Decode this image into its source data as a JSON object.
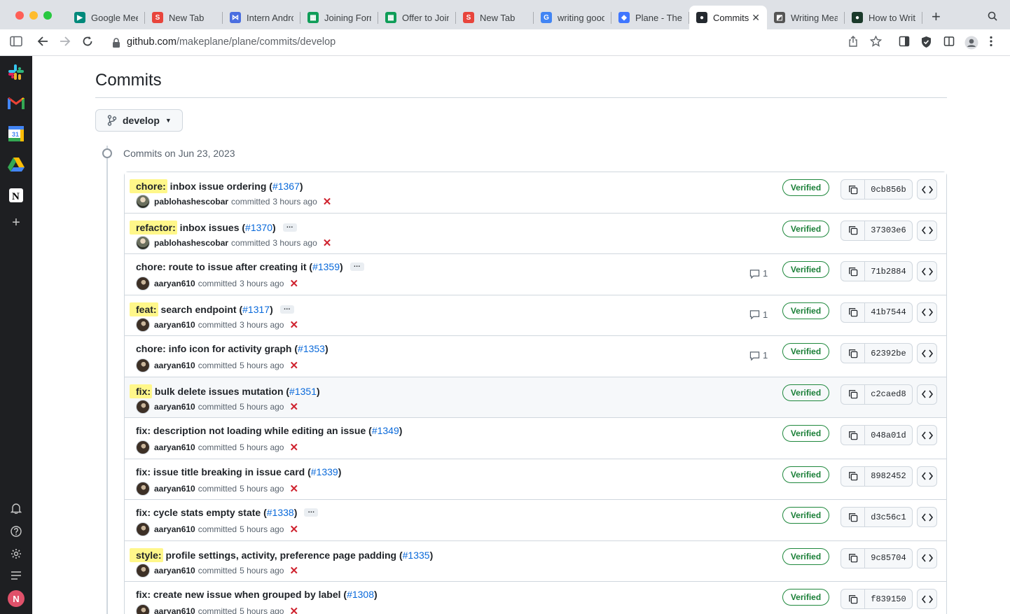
{
  "browser": {
    "tabs": [
      {
        "label": "Google Meet",
        "icon": "google-meet-icon",
        "color": "#00897b",
        "glyph": "▶"
      },
      {
        "label": "New Tab",
        "icon": "slash-icon",
        "color": "#e8453c",
        "glyph": "S"
      },
      {
        "label": "Intern Andrc",
        "icon": "bowtie-icon",
        "color": "#4a6ee0",
        "glyph": "⋈"
      },
      {
        "label": "Joining Form",
        "icon": "sheets-icon",
        "color": "#0f9d58",
        "glyph": "▦"
      },
      {
        "label": "Offer to Join",
        "icon": "sheets-icon",
        "color": "#0f9d58",
        "glyph": "▦"
      },
      {
        "label": "New Tab",
        "icon": "slash-icon",
        "color": "#e8453c",
        "glyph": "S"
      },
      {
        "label": "writing good",
        "icon": "google-icon",
        "color": "#4285f4",
        "glyph": "G"
      },
      {
        "label": "Plane - The",
        "icon": "plane-icon",
        "color": "#3f76ff",
        "glyph": "◆"
      },
      {
        "label": "Commits",
        "icon": "github-icon",
        "color": "#24292f",
        "glyph": "●",
        "active": true
      },
      {
        "label": "Writing Mea",
        "icon": "writing-icon",
        "color": "#555",
        "glyph": "◩"
      },
      {
        "label": "How to Writ",
        "icon": "medium-icon",
        "color": "#1b3a2b",
        "glyph": "●"
      }
    ],
    "url_host": "github.com",
    "url_path": "/makeplane/plane/commits/develop"
  },
  "page": {
    "title": "Commits",
    "branch": "develop",
    "date_heading": "Commits on Jun 23, 2023"
  },
  "commits": [
    {
      "prefix": "chore:",
      "highlight": true,
      "message": " inbox issue ordering (",
      "pr": "#1367",
      "suffix": ")",
      "ellipsis": false,
      "author": "pablohashescobar",
      "avatar": "alt",
      "verb": "committed",
      "time": "3 hours ago",
      "comments": "",
      "verified": "Verified",
      "sha": "0cb856b"
    },
    {
      "prefix": "refactor:",
      "highlight": true,
      "message": " inbox issues (",
      "pr": "#1370",
      "suffix": ")",
      "ellipsis": true,
      "author": "pablohashescobar",
      "avatar": "alt",
      "verb": "committed",
      "time": "3 hours ago",
      "comments": "",
      "verified": "Verified",
      "sha": "37303e6"
    },
    {
      "prefix": "",
      "highlight": false,
      "message": "chore: route to issue after creating it (",
      "pr": "#1359",
      "suffix": ")",
      "ellipsis": true,
      "author": "aaryan610",
      "avatar": "main",
      "verb": "committed",
      "time": "3 hours ago",
      "comments": "1",
      "verified": "Verified",
      "sha": "71b2884"
    },
    {
      "prefix": "feat:",
      "highlight": true,
      "message": " search endpoint (",
      "pr": "#1317",
      "suffix": ")",
      "ellipsis": true,
      "author": "aaryan610",
      "avatar": "main",
      "verb": "committed",
      "time": "3 hours ago",
      "comments": "1",
      "verified": "Verified",
      "sha": "41b7544"
    },
    {
      "prefix": "",
      "highlight": false,
      "message": "chore: info icon for activity graph (",
      "pr": "#1353",
      "suffix": ")",
      "ellipsis": false,
      "author": "aaryan610",
      "avatar": "main",
      "verb": "committed",
      "time": "5 hours ago",
      "comments": "1",
      "verified": "Verified",
      "sha": "62392be"
    },
    {
      "prefix": "fix:",
      "highlight": true,
      "message": " bulk delete issues mutation (",
      "pr": "#1351",
      "suffix": ")",
      "ellipsis": false,
      "author": "aaryan610",
      "avatar": "main",
      "verb": "committed",
      "time": "5 hours ago",
      "comments": "",
      "verified": "Verified",
      "sha": "c2caed8",
      "hover": true
    },
    {
      "prefix": "",
      "highlight": false,
      "message": "fix: description not loading while editing an issue (",
      "pr": "#1349",
      "suffix": ")",
      "ellipsis": false,
      "author": "aaryan610",
      "avatar": "main",
      "verb": "committed",
      "time": "5 hours ago",
      "comments": "",
      "verified": "Verified",
      "sha": "048a01d"
    },
    {
      "prefix": "",
      "highlight": false,
      "message": "fix: issue title breaking in issue card (",
      "pr": "#1339",
      "suffix": ")",
      "ellipsis": false,
      "author": "aaryan610",
      "avatar": "main",
      "verb": "committed",
      "time": "5 hours ago",
      "comments": "",
      "verified": "Verified",
      "sha": "8982452"
    },
    {
      "prefix": "",
      "highlight": false,
      "message": "fix: cycle stats empty state (",
      "pr": "#1338",
      "suffix": ")",
      "ellipsis": true,
      "author": "aaryan610",
      "avatar": "main",
      "verb": "committed",
      "time": "5 hours ago",
      "comments": "",
      "verified": "Verified",
      "sha": "d3c56c1"
    },
    {
      "prefix": "style:",
      "highlight": true,
      "message": " profile settings, activity, preference page padding (",
      "pr": "#1335",
      "suffix": ")",
      "ellipsis": false,
      "author": "aaryan610",
      "avatar": "main",
      "verb": "committed",
      "time": "5 hours ago",
      "comments": "",
      "verified": "Verified",
      "sha": "9c85704"
    },
    {
      "prefix": "",
      "highlight": false,
      "message": "fix: create new issue when grouped by label (",
      "pr": "#1308",
      "suffix": ")",
      "ellipsis": false,
      "author": "aaryan610",
      "avatar": "main",
      "verb": "committed",
      "time": "5 hours ago",
      "comments": "",
      "verified": "Verified",
      "sha": "f839150"
    }
  ],
  "dock": {
    "avatar_initial": "N",
    "apps": [
      "slack-icon",
      "gmail-icon",
      "calendar-icon",
      "drive-icon",
      "notion-icon",
      "add-icon"
    ],
    "tools": [
      "bell-icon",
      "help-icon",
      "settings-icon",
      "list-icon"
    ]
  }
}
